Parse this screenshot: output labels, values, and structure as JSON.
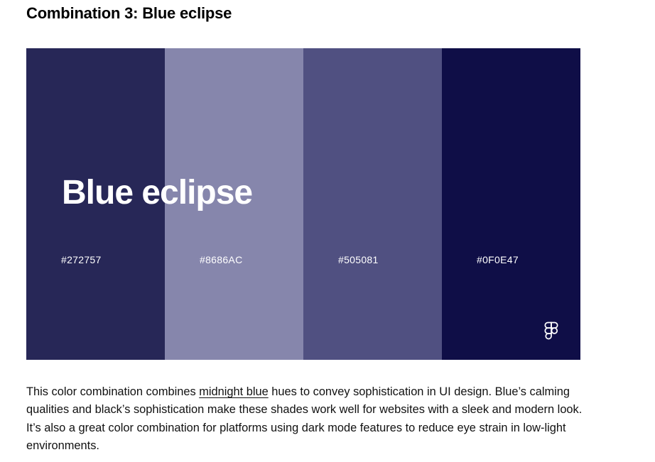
{
  "heading": "Combination 3: Blue eclipse",
  "palette": {
    "name": "Blue eclipse",
    "swatches": [
      {
        "hex_label": "#272757",
        "color": "#272757"
      },
      {
        "hex_label": "#8686AC",
        "color": "#8686AC"
      },
      {
        "hex_label": "#505081",
        "color": "#505081"
      },
      {
        "hex_label": "#0F0E47",
        "color": "#0F0E47"
      }
    ],
    "icon": "figma-icon"
  },
  "paragraph": {
    "before_link": "This color combination combines ",
    "link_text": "midnight blue",
    "after_link": " hues to convey sophistication in UI design. Blue’s calming qualities and black’s sophistication make these shades work well for websites with a sleek and modern look. It’s also a great color combination for platforms using dark mode features to reduce eye strain in low-light environments."
  }
}
